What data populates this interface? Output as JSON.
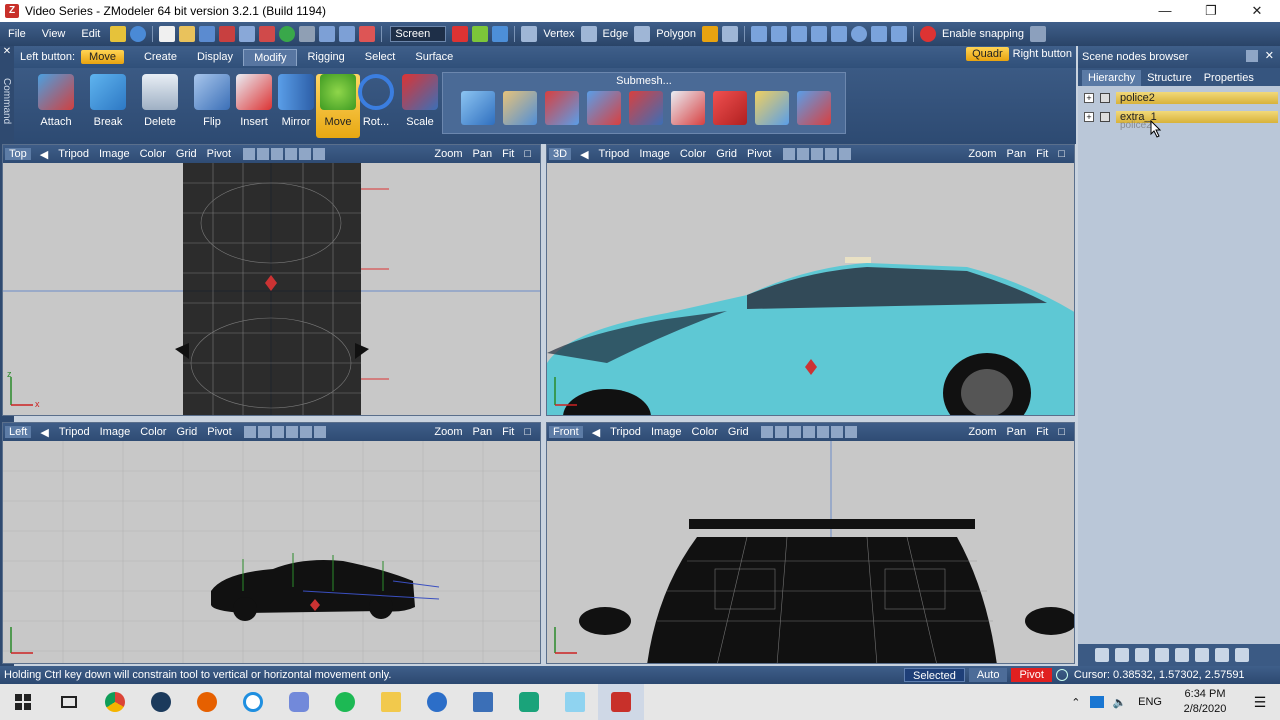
{
  "window": {
    "title": "Video Series - ZModeler 64 bit version 3.2.1 (Build 1194)",
    "app_icon": "zmodeler-icon"
  },
  "menu": {
    "items": [
      "File",
      "View",
      "Edit"
    ]
  },
  "toolbar": {
    "screen_select": "Screen",
    "vertex": "Vertex",
    "edge": "Edge",
    "polygon": "Polygon",
    "snapping": "Enable snapping"
  },
  "ribbon_tabs": {
    "left_button_label": "Left button:",
    "active_tool": "Move",
    "tabs": [
      "Create",
      "Display",
      "Modify",
      "Rigging",
      "Select",
      "Surface"
    ],
    "active_tab": "Modify",
    "quadr": "Quadr",
    "right_button_label": "Right button"
  },
  "command_strip": {
    "label": "Command"
  },
  "ribbon": {
    "tools": [
      "Attach",
      "Break",
      "Delete",
      "Flip",
      "Insert",
      "Mirror",
      "Move",
      "Rot...",
      "Scale"
    ],
    "active_tool": "Move",
    "submesh_label": "Submesh..."
  },
  "viewports": [
    {
      "name": "Top",
      "items": [
        "Tripod",
        "Image",
        "Color",
        "Grid",
        "Pivot"
      ],
      "zoom": "Zoom",
      "pan": "Pan",
      "fit": "Fit"
    },
    {
      "name": "3D",
      "items": [
        "Tripod",
        "Image",
        "Color",
        "Grid",
        "Pivot"
      ],
      "zoom": "Zoom",
      "pan": "Pan",
      "fit": "Fit"
    },
    {
      "name": "Left",
      "items": [
        "Tripod",
        "Image",
        "Color",
        "Grid",
        "Pivot"
      ],
      "zoom": "Zoom",
      "pan": "Pan",
      "fit": "Fit"
    },
    {
      "name": "Front",
      "items": [
        "Tripod",
        "Image",
        "Color",
        "Grid"
      ],
      "zoom": "Zoom",
      "pan": "Pan",
      "fit": "Fit"
    }
  ],
  "scene_browser": {
    "title": "Scene nodes browser",
    "tabs": [
      "Hierarchy",
      "Structure",
      "Properties"
    ],
    "active_tab": "Hierarchy",
    "nodes": [
      "police2",
      "extra_1"
    ],
    "drag_ghost": "police2"
  },
  "status": {
    "message": "Holding Ctrl key down will constrain tool to vertical or horizontal movement only.",
    "selected": "Selected",
    "auto": "Auto",
    "pivot": "Pivot",
    "cursor": "Cursor: 0.38532, 1.57302, 2.57591"
  },
  "taskbar": {
    "apps": [
      "chrome-icon",
      "steam-icon",
      "firefox-icon",
      "app-icon",
      "discord-icon",
      "spotify-icon",
      "explorer-icon",
      "support-icon",
      "store-icon",
      "game-icon",
      "shell-icon",
      "zmodeler-icon"
    ],
    "lang": "ENG",
    "time": "6:34 PM",
    "date": "2/8/2020"
  },
  "colors": {
    "chrome": "#2f4c74",
    "accent": "#e8a310",
    "viewport_bg": "#c8c8c8",
    "car_body": "#5ec8d4"
  }
}
